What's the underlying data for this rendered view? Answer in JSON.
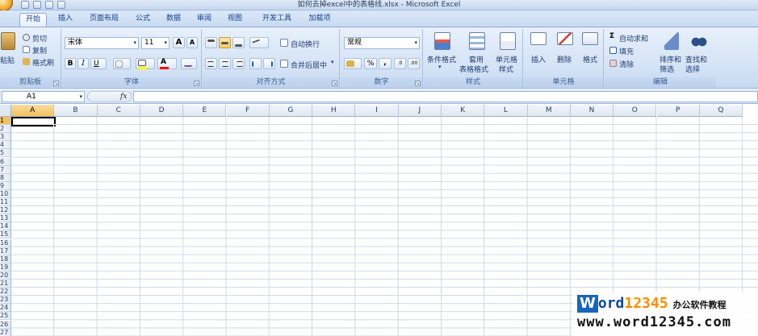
{
  "window": {
    "title": "如何去掉excel中的表格线.xlsx - Microsoft Excel"
  },
  "tabs": [
    "开始",
    "插入",
    "页面布局",
    "公式",
    "数据",
    "审阅",
    "视图",
    "开发工具",
    "加载项"
  ],
  "clipboard": {
    "paste": "粘贴",
    "cut": "剪切",
    "copy": "复制",
    "format_painter": "格式刷",
    "label": "剪贴板"
  },
  "font": {
    "name": "宋体",
    "size": "11",
    "grow": "A",
    "shrink": "A",
    "bold": "B",
    "italic": "I",
    "underline": "U",
    "color_letter": "A",
    "label": "字体"
  },
  "alignment": {
    "wrap": "自动换行",
    "merge": "合并后居中",
    "label": "对齐方式"
  },
  "number": {
    "format": "常规",
    "percent": "%",
    "comma": ",",
    "inc_decimal": ".0",
    "dec_decimal": ".00",
    "label": "数字"
  },
  "styles": {
    "cond": "条件格式",
    "table": "套用",
    "table2": "表格格式",
    "cell": "单元格",
    "cell2": "样式",
    "label": "样式"
  },
  "cells": {
    "insert": "插入",
    "delete": "删除",
    "format": "格式",
    "label": "单元格"
  },
  "editing": {
    "autosum": "自动求和",
    "fill": "填充",
    "clear": "清除",
    "sort": "排序和",
    "sort2": "筛选",
    "find": "查找和",
    "find2": "选择",
    "label": "编辑"
  },
  "formula_bar": {
    "name_box": "A1",
    "fx": "fx",
    "value": ""
  },
  "columns": [
    "A",
    "B",
    "C",
    "D",
    "E",
    "F",
    "G",
    "H",
    "I",
    "J",
    "K",
    "L",
    "M",
    "N",
    "O",
    "P",
    "Q"
  ],
  "rows": [
    "1",
    "2",
    "3",
    "4",
    "5",
    "6",
    "7",
    "8",
    "9",
    "10",
    "11",
    "12",
    "13",
    "14",
    "15",
    "16",
    "17",
    "18",
    "19",
    "20",
    "21",
    "22",
    "23",
    "24",
    "25",
    "26",
    "27",
    "28"
  ],
  "watermark": {
    "w": "W",
    "ord": "ord",
    "num": "12345",
    "cn": "办公软件教程",
    "url": "www.word12345.com"
  },
  "colors": {
    "ribbon": "#dbe8f8",
    "accent": "#15428b",
    "grid": "#d0d7e5",
    "active_header": "#f1c15f"
  }
}
